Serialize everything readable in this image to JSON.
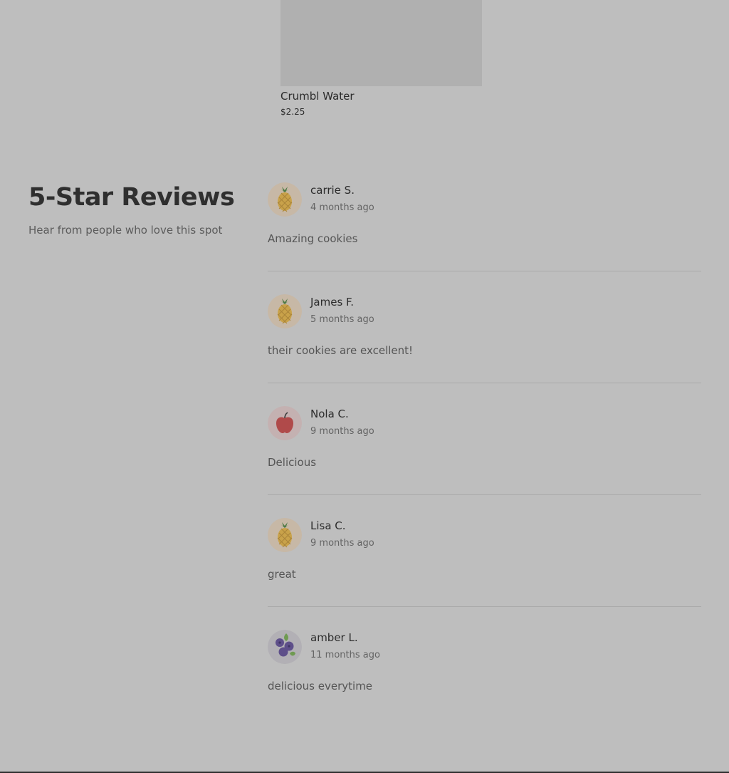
{
  "product": {
    "name": "Crumbl Water",
    "price": "$2.25"
  },
  "reviews_section": {
    "title": "5-Star Reviews",
    "subtitle": "Hear from people who love this spot"
  },
  "reviews": [
    {
      "name": "carrie S.",
      "time": "4 months ago",
      "text": "Amazing cookies",
      "avatar_icon": "pineapple-icon"
    },
    {
      "name": "James F.",
      "time": "5 months ago",
      "text": "their cookies are excellent!",
      "avatar_icon": "pineapple-icon"
    },
    {
      "name": "Nola C.",
      "time": "9 months ago",
      "text": "Delicious",
      "avatar_icon": "apple-icon"
    },
    {
      "name": "Lisa C.",
      "time": "9 months ago",
      "text": "great",
      "avatar_icon": "pineapple-icon"
    },
    {
      "name": "amber L.",
      "time": "11 months ago",
      "text": "delicious everytime",
      "avatar_icon": "blueberry-icon"
    }
  ],
  "colors": {
    "page_overlay": "#bebebe",
    "image_placeholder": "#b0b0b0",
    "divider": "#a9a9a9",
    "pineapple_avatar_bg": "#c7b8a6",
    "apple_avatar_bg": "#c4b1b1",
    "blueberry_avatar_bg": "#b2b0b5"
  }
}
